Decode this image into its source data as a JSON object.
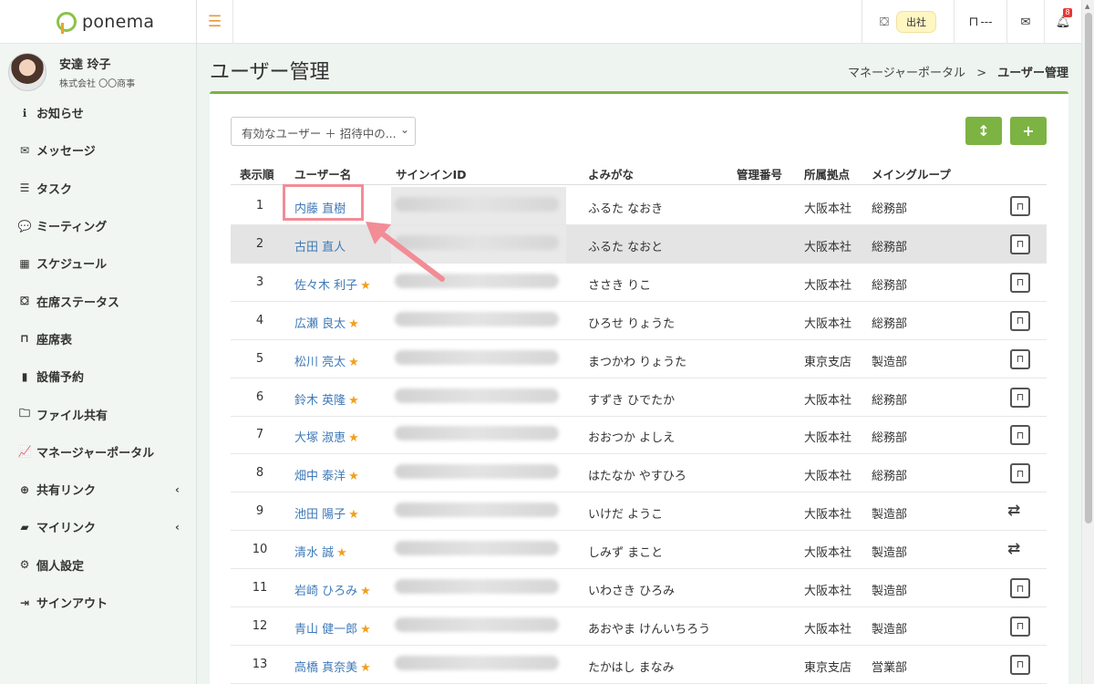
{
  "app": {
    "brand": "ponema"
  },
  "colors": {
    "accent_green": "#7cb342",
    "link_blue": "#3f7ab8",
    "star": "#f0a020",
    "highlight": "#f28c96"
  },
  "user": {
    "name": "安達 玲子",
    "company": "株式会社 〇〇商事"
  },
  "sidebar": {
    "items": [
      {
        "label": "お知らせ",
        "icon": "info-circle-icon",
        "glyph": "ℹ"
      },
      {
        "label": "メッセージ",
        "icon": "envelope-icon",
        "glyph": "✉"
      },
      {
        "label": "タスク",
        "icon": "tasks-icon",
        "glyph": "☰"
      },
      {
        "label": "ミーティング",
        "icon": "comments-icon",
        "glyph": "💬"
      },
      {
        "label": "スケジュール",
        "icon": "calendar-icon",
        "glyph": "▦"
      },
      {
        "label": "在席ステータス",
        "icon": "status-icon",
        "glyph": "⛋"
      },
      {
        "label": "座席表",
        "icon": "chair-icon",
        "glyph": "⊓"
      },
      {
        "label": "設備予約",
        "icon": "book-icon",
        "glyph": "▮"
      },
      {
        "label": "ファイル共有",
        "icon": "folder-icon",
        "glyph": "🗀"
      },
      {
        "label": "マネージャーポータル",
        "icon": "chart-icon",
        "glyph": "📈"
      },
      {
        "label": "共有リンク",
        "icon": "globe-icon",
        "glyph": "⊕",
        "caret": "‹"
      },
      {
        "label": "マイリンク",
        "icon": "bookmark-icon",
        "glyph": "▰",
        "caret": "‹"
      },
      {
        "label": "個人設定",
        "icon": "gear-icon",
        "glyph": "⚙"
      },
      {
        "label": "サインアウト",
        "icon": "sign-out-icon",
        "glyph": "⇥"
      }
    ]
  },
  "header": {
    "attendance_label": "出社",
    "seat_status": "---",
    "notification_count": "8"
  },
  "page": {
    "title": "ユーザー管理"
  },
  "breadcrumb": {
    "parent": "マネージャーポータル",
    "separator": ">",
    "current": "ユーザー管理"
  },
  "filter": {
    "selected": "有効なユーザー ＋ 招待中の..."
  },
  "table": {
    "headers": {
      "order": "表示順",
      "username": "ユーザー名",
      "signin": "サインインID",
      "kana": "よみがな",
      "number": "管理番号",
      "location": "所属拠点",
      "group": "メイングループ"
    },
    "rows": [
      {
        "order": "1",
        "name": "内藤 直樹",
        "star": false,
        "kana": "ふるた なおき",
        "location": "大阪本社",
        "group": "総務部",
        "action": "seat"
      },
      {
        "order": "2",
        "name": "古田 直人",
        "star": false,
        "kana": "ふるた なおと",
        "location": "大阪本社",
        "group": "総務部",
        "action": "seat"
      },
      {
        "order": "3",
        "name": "佐々木 利子",
        "star": true,
        "kana": "ささき りこ",
        "location": "大阪本社",
        "group": "総務部",
        "action": "seat"
      },
      {
        "order": "4",
        "name": "広瀬 良太",
        "star": true,
        "kana": "ひろせ りょうた",
        "location": "大阪本社",
        "group": "総務部",
        "action": "seat"
      },
      {
        "order": "5",
        "name": "松川 亮太",
        "star": true,
        "kana": "まつかわ りょうた",
        "location": "東京支店",
        "group": "製造部",
        "action": "seat"
      },
      {
        "order": "6",
        "name": "鈴木 英隆",
        "star": true,
        "kana": "すずき ひでたか",
        "location": "大阪本社",
        "group": "総務部",
        "action": "seat"
      },
      {
        "order": "7",
        "name": "大塚 淑恵",
        "star": true,
        "kana": "おおつか よしえ",
        "location": "大阪本社",
        "group": "総務部",
        "action": "seat"
      },
      {
        "order": "8",
        "name": "畑中 泰洋",
        "star": true,
        "kana": "はたなか やすひろ",
        "location": "大阪本社",
        "group": "総務部",
        "action": "seat"
      },
      {
        "order": "9",
        "name": "池田 陽子",
        "star": true,
        "kana": "いけだ ようこ",
        "location": "大阪本社",
        "group": "製造部",
        "action": "swap"
      },
      {
        "order": "10",
        "name": "清水 誠",
        "star": true,
        "kana": "しみず まこと",
        "location": "大阪本社",
        "group": "製造部",
        "action": "swap"
      },
      {
        "order": "11",
        "name": "岩崎 ひろみ",
        "star": true,
        "kana": "いわさき ひろみ",
        "location": "大阪本社",
        "group": "製造部",
        "action": "seat"
      },
      {
        "order": "12",
        "name": "青山 健一郎",
        "star": true,
        "kana": "あおやま けんいちろう",
        "location": "大阪本社",
        "group": "製造部",
        "action": "seat"
      },
      {
        "order": "13",
        "name": "高橋 真奈美",
        "star": true,
        "kana": "たかはし まなみ",
        "location": "東京支店",
        "group": "営業部",
        "action": "seat"
      }
    ]
  }
}
